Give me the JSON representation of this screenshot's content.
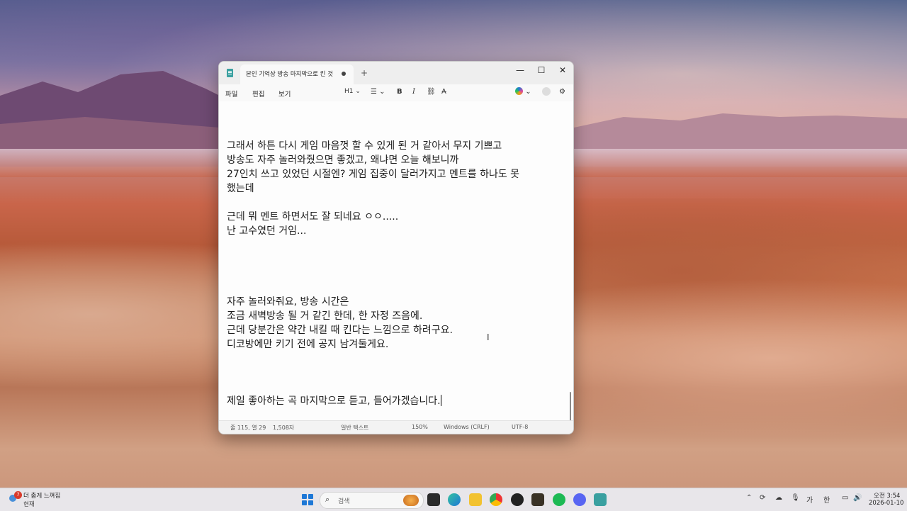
{
  "window": {
    "tab_title": "본인 기억상 방송 마지막으로 킨 것",
    "new_tab": "+",
    "minimize": "—",
    "maximize": "☐",
    "close": "✕"
  },
  "menu": {
    "file": "파일",
    "edit": "편집",
    "view": "보기"
  },
  "toolbar": {
    "heading": "H1",
    "bold": "B",
    "italic": "I"
  },
  "editor_lines": [
    "그래서 하튼 다시 게임 마음껏 할 수 있게 된 거 같아서 무지 기쁘고",
    "방송도 자주 놀러와줬으면 좋겠고, 왜냐면 오늘 해보니까",
    "27인치 쓰고 있었던 시절엔? 게임 집중이 달러가지고 멘트를 하나도 못",
    "했는데",
    "",
    "근데 뭐 멘트 하면서도 잘 되네요 ㅇㅇ.....",
    "난 고수였던 거임...",
    "",
    "",
    "",
    "",
    "자주 놀러와줘요, 방송 시간은",
    "조금 새벽방송 될 거 같긴 한데, 한 자정 즈음에.",
    "근데 당분간은 약간 내킬 때 킨다는 느낌으로 하려구요.",
    "디코방에만 키기 전에 공지 남겨둘게요.",
    "",
    "",
    "",
    "제일 좋아하는 곡 마지막으로 듣고, 들어가겠습니다."
  ],
  "status": {
    "position": "줄 115, 열 29",
    "chars": "1,508자",
    "text_type": "일반 텍스트",
    "zoom": "150%",
    "line_ending": "Windows (CRLF)",
    "encoding": "UTF-8"
  },
  "taskbar": {
    "weather_badge": "7",
    "weather_title": "더 춥게 느껴짐",
    "weather_sub": "현재",
    "search_placeholder": "검색",
    "ime1": "가",
    "ime2": "한",
    "time": "오전 3:54",
    "date": "2026-01-10"
  },
  "colors": {
    "accent": "#1e78d6",
    "window_bg": "#f9f9f9"
  }
}
